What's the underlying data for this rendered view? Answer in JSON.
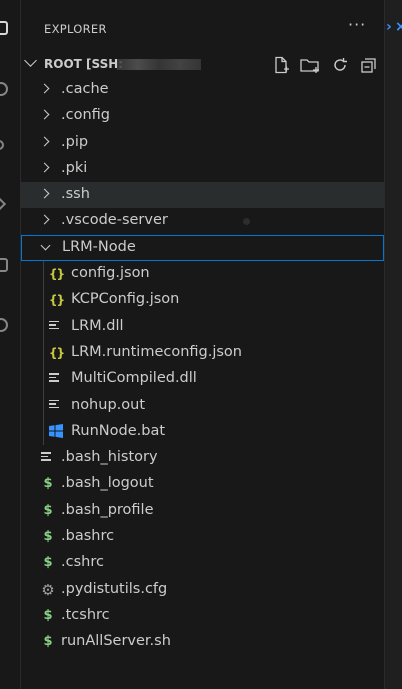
{
  "explorer": {
    "title": "EXPLORER",
    "more_label": "···",
    "root_label": "ROOT [SSH:",
    "actions": [
      "new-file-icon",
      "new-folder-icon",
      "refresh-icon",
      "collapse-all-icon"
    ]
  },
  "tree": [
    {
      "label": ".cache",
      "type": "folder",
      "expanded": false,
      "depth": 0
    },
    {
      "label": ".config",
      "type": "folder",
      "expanded": false,
      "depth": 0
    },
    {
      "label": ".pip",
      "type": "folder",
      "expanded": false,
      "depth": 0
    },
    {
      "label": ".pki",
      "type": "folder",
      "expanded": false,
      "depth": 0
    },
    {
      "label": ".ssh",
      "type": "folder",
      "expanded": false,
      "depth": 0,
      "state": "selected"
    },
    {
      "label": ".vscode-server",
      "type": "folder",
      "expanded": false,
      "depth": 0
    },
    {
      "label": "LRM-Node",
      "type": "folder",
      "expanded": true,
      "depth": 0,
      "state": "focused"
    },
    {
      "label": "config.json",
      "type": "json",
      "depth": 1
    },
    {
      "label": "KCPConfig.json",
      "type": "json",
      "depth": 1
    },
    {
      "label": "LRM.dll",
      "type": "text",
      "depth": 1
    },
    {
      "label": "LRM.runtimeconfig.json",
      "type": "json",
      "depth": 1
    },
    {
      "label": "MultiCompiled.dll",
      "type": "text",
      "depth": 1
    },
    {
      "label": "nohup.out",
      "type": "text",
      "depth": 1
    },
    {
      "label": "RunNode.bat",
      "type": "windows",
      "depth": 1
    },
    {
      "label": ".bash_history",
      "type": "text",
      "depth": 0
    },
    {
      "label": ".bash_logout",
      "type": "shell",
      "depth": 0
    },
    {
      "label": ".bash_profile",
      "type": "shell",
      "depth": 0
    },
    {
      "label": ".bashrc",
      "type": "shell",
      "depth": 0
    },
    {
      "label": ".cshrc",
      "type": "shell",
      "depth": 0
    },
    {
      "label": ".pydistutils.cfg",
      "type": "config",
      "depth": 0
    },
    {
      "label": ".tcshrc",
      "type": "shell",
      "depth": 0
    },
    {
      "label": "runAllServer.sh",
      "type": "shell",
      "depth": 0
    }
  ],
  "colors": {
    "accent": "#0078d4",
    "json_icon": "#cbcb41",
    "shell_icon": "#89d185",
    "windows_icon": "#3794ff"
  }
}
